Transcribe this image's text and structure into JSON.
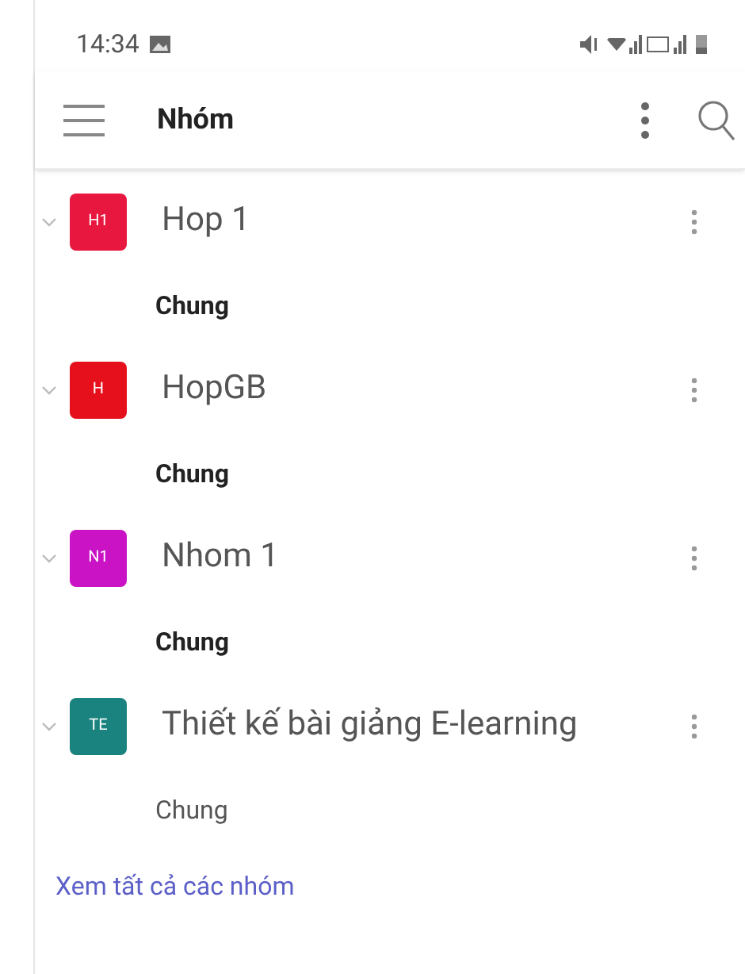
{
  "status_bar": {
    "time": "14:34"
  },
  "app_bar": {
    "title": "Nhóm"
  },
  "teams": [
    {
      "initials": "H1",
      "name": "Hop 1",
      "color": "#e8173f",
      "expanded": true,
      "channels": [
        {
          "name": "Chung",
          "unread": true
        }
      ]
    },
    {
      "initials": "H",
      "name": "HopGB",
      "color": "#e5101b",
      "expanded": true,
      "channels": [
        {
          "name": "Chung",
          "unread": true
        }
      ]
    },
    {
      "initials": "N1",
      "name": "Nhom 1",
      "color": "#c913c4",
      "expanded": true,
      "channels": [
        {
          "name": "Chung",
          "unread": true
        }
      ]
    },
    {
      "initials": "TE",
      "name": "Thiết kế bài giảng E-learning",
      "color": "#1b837f",
      "expanded": true,
      "channels": [
        {
          "name": "Chung",
          "unread": false
        }
      ]
    }
  ],
  "see_all_link": "Xem tất cả các nhóm"
}
